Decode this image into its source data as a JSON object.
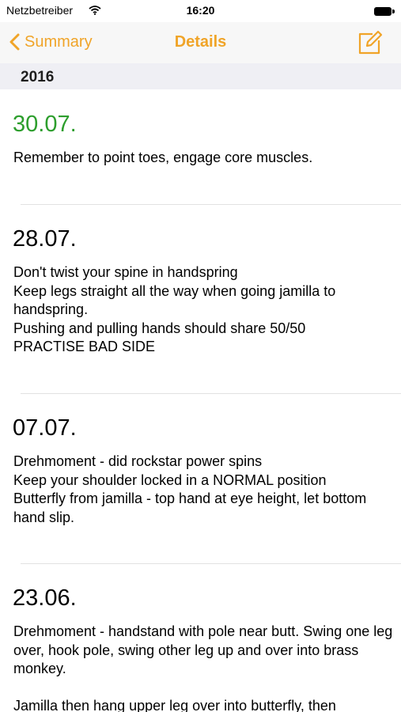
{
  "status_bar": {
    "carrier": "Netzbetreiber",
    "time": "16:20"
  },
  "nav": {
    "back_label": "Summary",
    "title": "Details"
  },
  "section": {
    "year": "2016"
  },
  "colors": {
    "accent": "#f0a428",
    "latest_date": "#2d9e2d"
  },
  "entries": [
    {
      "date": "30.07.",
      "text": "Remember to point toes, engage core muscles."
    },
    {
      "date": "28.07.",
      "text": "Don't twist your spine in handspring\nKeep legs straight all the way when going jamilla to handspring.\nPushing and pulling hands should share 50/50\nPRACTISE BAD SIDE"
    },
    {
      "date": "07.07.",
      "text": "Drehmoment - did rockstar power spins\nKeep your shoulder locked in a NORMAL position\nButterfly from jamilla - top hand at eye height, let bottom hand slip."
    },
    {
      "date": "23.06.",
      "text": "Drehmoment - handstand with pole near butt. Swing one leg over, hook pole, swing other leg up and over into brass monkey.\n\nJamilla then hang upper leg over into butterfly, then"
    }
  ]
}
